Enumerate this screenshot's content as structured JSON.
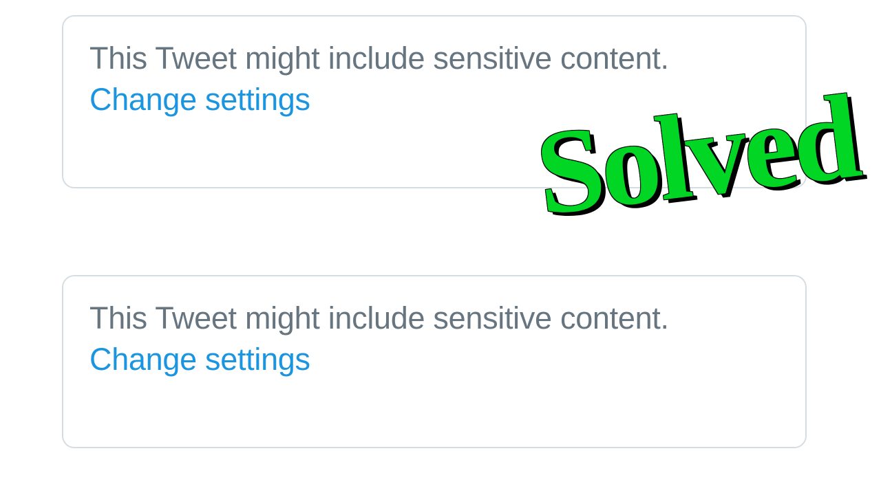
{
  "cards": [
    {
      "warning_text": "This Tweet might include sensitive content.",
      "link_text": "Change settings"
    },
    {
      "warning_text": "This Tweet might include sensitive content.",
      "link_text": "Change settings"
    }
  ],
  "overlay": {
    "label": "Solved"
  },
  "colors": {
    "text_gray": "#66757f",
    "link_blue": "#1b95e0",
    "border_gray": "#d6dde2",
    "solved_green": "#00d623"
  }
}
